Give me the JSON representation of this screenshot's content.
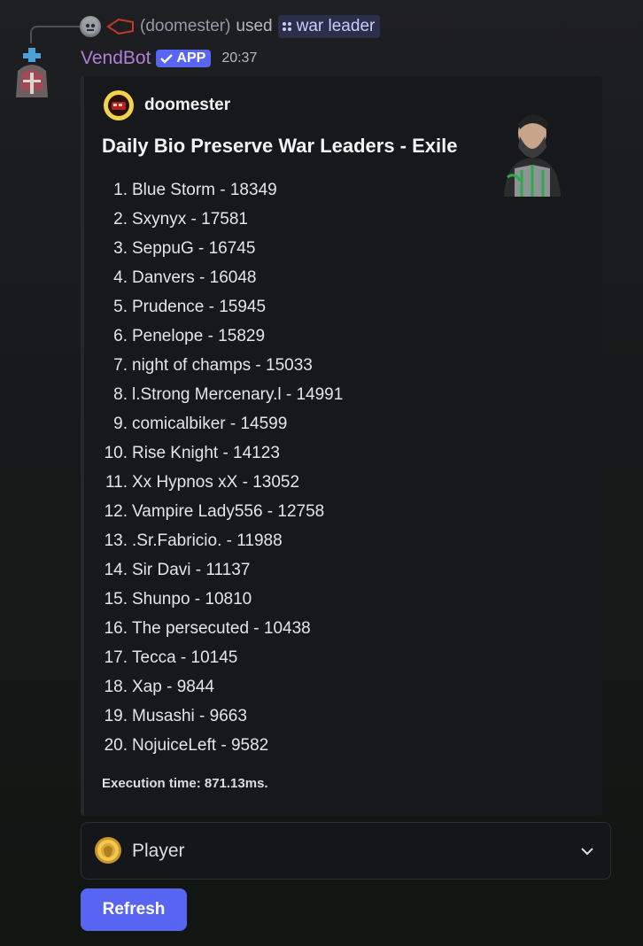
{
  "reply": {
    "user": "(doomester)",
    "verb": "used",
    "command": "war leader",
    "user_avatar_icon": "mask-avatar-icon",
    "tag_icon": "red-arrow-tag-icon",
    "command_icon": "app-command-icon"
  },
  "message": {
    "author": "VendBot",
    "badge": "APP",
    "timestamp": "20:37",
    "avatar_icon": "armored-knight-avatar",
    "name_color": "#b07fd6",
    "badge_color": "#5865f2"
  },
  "embed": {
    "author_name": "doomester",
    "author_icon": "red-bus-icon",
    "title": "Daily Bio Preserve War Leaders - Exile",
    "thumbnail": "bearded-warrior-thumbnail",
    "leaderboard": [
      {
        "rank": "1.",
        "text": "Blue Storm - 18349"
      },
      {
        "rank": "2.",
        "text": "Sxynyx - 17581"
      },
      {
        "rank": "3.",
        "text": "SeppuG - 16745"
      },
      {
        "rank": "4.",
        "text": "Danvers - 16048"
      },
      {
        "rank": "5.",
        "text": "Prudence - 15945"
      },
      {
        "rank": "6.",
        "text": "Penelope - 15829"
      },
      {
        "rank": "7.",
        "text": "night of champs - 15033"
      },
      {
        "rank": "8.",
        "text": "l.Strong Mercenary.l - 14991"
      },
      {
        "rank": "9.",
        "text": "comicalbiker - 14599"
      },
      {
        "rank": "10.",
        "text": "Rise Knight - 14123"
      },
      {
        "rank": "11.",
        "text": "Xx Hypnos xX - 13052"
      },
      {
        "rank": "12.",
        "text": "Vampire Lady556 - 12758"
      },
      {
        "rank": "13.",
        "text": ".Sr.Fabricio. - 11988"
      },
      {
        "rank": "14.",
        "text": "Sir Davi - 11137"
      },
      {
        "rank": "15.",
        "text": "Shunpo - 10810"
      },
      {
        "rank": "16.",
        "text": "The persecuted - 10438"
      },
      {
        "rank": "17.",
        "text": "Tecca - 10145"
      },
      {
        "rank": "18.",
        "text": "Xap - 9844"
      },
      {
        "rank": "19.",
        "text": "Musashi - 9663"
      },
      {
        "rank": "20.",
        "text": "NojuiceLeft - 9582"
      }
    ],
    "footer": "Execution time: 871.13ms."
  },
  "select_menu": {
    "label": "Player",
    "icon": "gold-lion-coin-icon",
    "chevron_icon": "chevron-down-icon"
  },
  "refresh_button": {
    "label": "Refresh",
    "color": "#5865f2"
  }
}
